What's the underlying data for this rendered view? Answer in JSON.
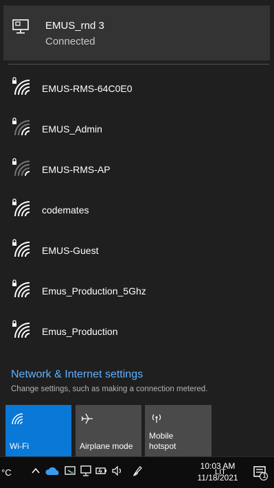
{
  "connected_network": {
    "name": "EMUS_rnd 3",
    "status": "Connected"
  },
  "networks": [
    {
      "name": "EMUS-RMS-64C0E0",
      "secured": true
    },
    {
      "name": "EMUS_Admin",
      "secured": true
    },
    {
      "name": "EMUS-RMS-AP",
      "secured": true
    },
    {
      "name": "codemates",
      "secured": true
    },
    {
      "name": "EMUS-Guest",
      "secured": true
    },
    {
      "name": "Emus_Production_5Ghz",
      "secured": true
    },
    {
      "name": "Emus_Production",
      "secured": true
    }
  ],
  "settings": {
    "link": "Network & Internet settings",
    "description": "Change settings, such as making a connection metered."
  },
  "quick_actions": {
    "wifi": {
      "label": "Wi-Fi",
      "icon": "wifi-icon",
      "active": true
    },
    "airplane": {
      "label": "Airplane mode",
      "icon": "airplane-icon",
      "active": false
    },
    "hotspot": {
      "label_line1": "Mobile",
      "label_line2": "hotspot",
      "icon": "hotspot-icon",
      "active": false
    }
  },
  "taskbar": {
    "temperature_unit": "°C",
    "language": "LIT",
    "time": "10:03 AM",
    "date": "11/18/2021",
    "notification_count": "1"
  },
  "colors": {
    "flyout_bg": "#1f1f1f",
    "connected_bg": "#333333",
    "accent": "#0a78d7",
    "link": "#5fb3ff",
    "tile_inactive": "#4a4a4a",
    "taskbar_bg": "#0d0d0d"
  }
}
